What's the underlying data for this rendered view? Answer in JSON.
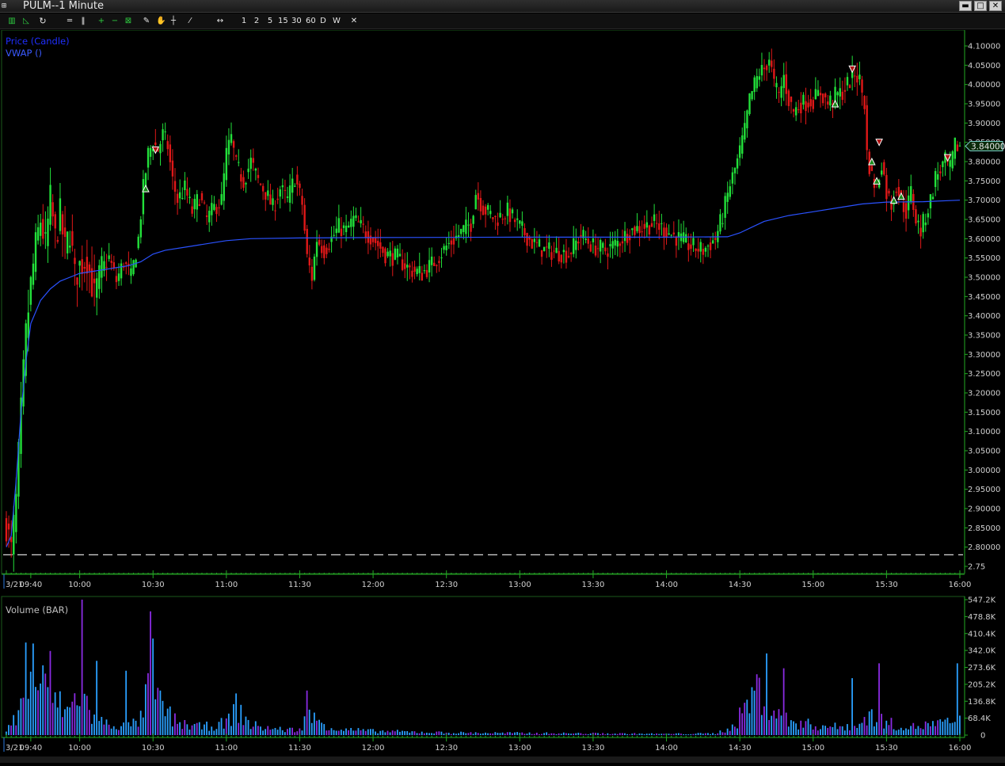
{
  "window": {
    "title": "PULM--1 Minute",
    "app_icon": "chart-app-icon",
    "controls": {
      "minimize": "▬",
      "maximize": "□",
      "close": "✕"
    }
  },
  "toolbar": {
    "periods": [
      "1",
      "2",
      "5",
      "15",
      "30",
      "60",
      "D",
      "W"
    ],
    "close_glyph": "✕"
  },
  "colors": {
    "up": "#22e03a",
    "down": "#e01818",
    "vwap": "#2a52ff",
    "axis": "#22aa22",
    "volume_blue": "#2aa0ff",
    "volume_purple": "#8a2be2",
    "legend_price": "#1f2fff",
    "legend_vwap": "#3a5aff"
  },
  "price_panel": {
    "legend": [
      "Price (Candle)",
      "VWAP ()"
    ],
    "last_price": "3.84000",
    "y_ticks": [
      "4.10000",
      "4.05000",
      "4.00000",
      "3.95000",
      "3.90000",
      "3.85000",
      "3.80000",
      "3.75000",
      "3.70000",
      "3.65000",
      "3.60000",
      "3.55000",
      "3.50000",
      "3.45000",
      "3.40000",
      "3.35000",
      "3.30000",
      "3.25000",
      "3.20000",
      "3.15000",
      "3.10000",
      "3.05000",
      "3.00000",
      "2.95000",
      "2.90000",
      "2.85000",
      "2.80000",
      "2.75"
    ],
    "date_label": "3/21",
    "x_ticks": [
      "09:40",
      "10:00",
      "10:30",
      "11:00",
      "11:30",
      "12:00",
      "12:30",
      "13:00",
      "13:30",
      "14:00",
      "14:30",
      "15:00",
      "15:30",
      "16:00"
    ]
  },
  "volume_panel": {
    "legend": "Volume (BAR)",
    "y_ticks": [
      "547.2K",
      "478.8K",
      "410.4K",
      "342.0K",
      "273.6K",
      "205.2K",
      "136.8K",
      "68.4K",
      "0"
    ],
    "date_label": "3/21",
    "x_ticks": [
      "09:40",
      "10:00",
      "10:30",
      "11:00",
      "11:30",
      "12:00",
      "12:30",
      "13:00",
      "13:30",
      "14:00",
      "14:30",
      "15:00",
      "15:30",
      "16:00"
    ]
  },
  "chart_data": [
    {
      "type": "candlestick",
      "title": "PULM--1 Minute",
      "series": [
        {
          "name": "Price (Candle)"
        },
        {
          "name": "VWAP ()"
        }
      ],
      "ylim": [
        2.75,
        4.12
      ],
      "x_range": [
        "09:30",
        "16:00"
      ],
      "path": [
        [
          "09:30",
          2.86
        ],
        [
          "09:32",
          2.79
        ],
        [
          "09:34",
          2.92
        ],
        [
          "09:36",
          3.15
        ],
        [
          "09:38",
          3.35
        ],
        [
          "09:40",
          3.48
        ],
        [
          "09:42",
          3.58
        ],
        [
          "09:44",
          3.65
        ],
        [
          "09:46",
          3.58
        ],
        [
          "09:48",
          3.7
        ],
        [
          "09:50",
          3.6
        ],
        [
          "09:52",
          3.66
        ],
        [
          "09:54",
          3.57
        ],
        [
          "09:56",
          3.62
        ],
        [
          "09:58",
          3.5
        ],
        [
          "10:00",
          3.53
        ],
        [
          "10:03",
          3.55
        ],
        [
          "10:06",
          3.45
        ],
        [
          "10:09",
          3.52
        ],
        [
          "10:12",
          3.55
        ],
        [
          "10:15",
          3.49
        ],
        [
          "10:18",
          3.54
        ],
        [
          "10:21",
          3.5
        ],
        [
          "10:24",
          3.6
        ],
        [
          "10:26",
          3.73
        ],
        [
          "10:28",
          3.82
        ],
        [
          "10:30",
          3.85
        ],
        [
          "10:32",
          3.83
        ],
        [
          "10:34",
          3.87
        ],
        [
          "10:36",
          3.84
        ],
        [
          "10:38",
          3.75
        ],
        [
          "10:40",
          3.7
        ],
        [
          "10:43",
          3.73
        ],
        [
          "10:46",
          3.67
        ],
        [
          "10:49",
          3.71
        ],
        [
          "10:52",
          3.65
        ],
        [
          "10:55",
          3.68
        ],
        [
          "10:58",
          3.7
        ],
        [
          "11:00",
          3.82
        ],
        [
          "11:02",
          3.86
        ],
        [
          "11:04",
          3.79
        ],
        [
          "11:07",
          3.75
        ],
        [
          "11:10",
          3.8
        ],
        [
          "11:13",
          3.75
        ],
        [
          "11:16",
          3.72
        ],
        [
          "11:19",
          3.68
        ],
        [
          "11:22",
          3.73
        ],
        [
          "11:25",
          3.7
        ],
        [
          "11:28",
          3.76
        ],
        [
          "11:31",
          3.69
        ],
        [
          "11:33",
          3.55
        ],
        [
          "11:35",
          3.5
        ],
        [
          "11:37",
          3.6
        ],
        [
          "11:40",
          3.57
        ],
        [
          "11:43",
          3.6
        ],
        [
          "11:46",
          3.63
        ],
        [
          "11:49",
          3.62
        ],
        [
          "11:52",
          3.65
        ],
        [
          "11:55",
          3.63
        ],
        [
          "12:00",
          3.6
        ],
        [
          "12:05",
          3.56
        ],
        [
          "12:10",
          3.55
        ],
        [
          "12:15",
          3.52
        ],
        [
          "12:20",
          3.51
        ],
        [
          "12:25",
          3.54
        ],
        [
          "12:30",
          3.58
        ],
        [
          "12:35",
          3.61
        ],
        [
          "12:40",
          3.64
        ],
        [
          "12:42",
          3.72
        ],
        [
          "12:45",
          3.68
        ],
        [
          "12:50",
          3.65
        ],
        [
          "12:55",
          3.67
        ],
        [
          "13:00",
          3.63
        ],
        [
          "13:05",
          3.59
        ],
        [
          "13:10",
          3.57
        ],
        [
          "13:20",
          3.56
        ],
        [
          "13:25",
          3.61
        ],
        [
          "13:30",
          3.58
        ],
        [
          "13:35",
          3.57
        ],
        [
          "13:40",
          3.59
        ],
        [
          "13:45",
          3.62
        ],
        [
          "13:50",
          3.63
        ],
        [
          "13:55",
          3.64
        ],
        [
          "14:00",
          3.62
        ],
        [
          "14:05",
          3.6
        ],
        [
          "14:10",
          3.58
        ],
        [
          "14:15",
          3.57
        ],
        [
          "14:20",
          3.6
        ],
        [
          "14:23",
          3.66
        ],
        [
          "14:26",
          3.74
        ],
        [
          "14:29",
          3.8
        ],
        [
          "14:32",
          3.88
        ],
        [
          "14:34",
          3.96
        ],
        [
          "14:36",
          4.0
        ],
        [
          "14:38",
          4.03
        ],
        [
          "14:40",
          4.04
        ],
        [
          "14:42",
          4.07
        ],
        [
          "14:44",
          4.0
        ],
        [
          "14:46",
          3.97
        ],
        [
          "14:48",
          4.02
        ],
        [
          "14:50",
          3.96
        ],
        [
          "14:52",
          3.93
        ],
        [
          "14:55",
          3.95
        ],
        [
          "15:00",
          3.96
        ],
        [
          "15:03",
          3.98
        ],
        [
          "15:06",
          3.95
        ],
        [
          "15:09",
          3.97
        ],
        [
          "15:12",
          3.98
        ],
        [
          "15:15",
          4.01
        ],
        [
          "15:17",
          4.03
        ],
        [
          "15:19",
          4.01
        ],
        [
          "15:21",
          3.95
        ],
        [
          "15:22",
          3.82
        ],
        [
          "15:24",
          3.76
        ],
        [
          "15:26",
          3.73
        ],
        [
          "15:28",
          3.8
        ],
        [
          "15:30",
          3.72
        ],
        [
          "15:32",
          3.69
        ],
        [
          "15:34",
          3.74
        ],
        [
          "15:36",
          3.7
        ],
        [
          "15:38",
          3.67
        ],
        [
          "15:40",
          3.72
        ],
        [
          "15:42",
          3.65
        ],
        [
          "15:44",
          3.62
        ],
        [
          "15:46",
          3.66
        ],
        [
          "15:48",
          3.7
        ],
        [
          "15:50",
          3.76
        ],
        [
          "15:52",
          3.78
        ],
        [
          "15:54",
          3.8
        ],
        [
          "15:56",
          3.78
        ],
        [
          "15:58",
          3.84
        ],
        [
          "16:00",
          3.84
        ]
      ],
      "vwap": [
        [
          "09:30",
          2.8
        ],
        [
          "09:32",
          2.83
        ],
        [
          "09:34",
          2.97
        ],
        [
          "09:36",
          3.15
        ],
        [
          "09:38",
          3.28
        ],
        [
          "09:40",
          3.38
        ],
        [
          "09:44",
          3.44
        ],
        [
          "09:48",
          3.47
        ],
        [
          "09:52",
          3.49
        ],
        [
          "09:56",
          3.5
        ],
        [
          "10:00",
          3.51
        ],
        [
          "10:10",
          3.52
        ],
        [
          "10:20",
          3.53
        ],
        [
          "10:25",
          3.54
        ],
        [
          "10:30",
          3.56
        ],
        [
          "10:35",
          3.57
        ],
        [
          "10:45",
          3.58
        ],
        [
          "10:55",
          3.59
        ],
        [
          "11:00",
          3.595
        ],
        [
          "11:10",
          3.6
        ],
        [
          "11:30",
          3.602
        ],
        [
          "12:00",
          3.603
        ],
        [
          "13:00",
          3.604
        ],
        [
          "14:00",
          3.604
        ],
        [
          "14:25",
          3.605
        ],
        [
          "14:30",
          3.615
        ],
        [
          "14:35",
          3.63
        ],
        [
          "14:40",
          3.645
        ],
        [
          "14:50",
          3.66
        ],
        [
          "15:00",
          3.67
        ],
        [
          "15:10",
          3.68
        ],
        [
          "15:20",
          3.69
        ],
        [
          "15:30",
          3.695
        ],
        [
          "15:45",
          3.696
        ],
        [
          "16:00",
          3.7
        ]
      ],
      "markers": [
        {
          "time": "10:27",
          "price": 3.73,
          "kind": "up"
        },
        {
          "time": "10:31",
          "price": 3.83,
          "kind": "down"
        },
        {
          "time": "15:09",
          "price": 3.95,
          "kind": "up"
        },
        {
          "time": "15:16",
          "price": 4.04,
          "kind": "down"
        },
        {
          "time": "15:24",
          "price": 3.8,
          "kind": "up"
        },
        {
          "time": "15:26",
          "price": 3.75,
          "kind": "up"
        },
        {
          "time": "15:27",
          "price": 3.85,
          "kind": "down"
        },
        {
          "time": "15:33",
          "price": 3.7,
          "kind": "up"
        },
        {
          "time": "15:36",
          "price": 3.71,
          "kind": "up"
        },
        {
          "time": "15:55",
          "price": 3.81,
          "kind": "down"
        }
      ],
      "reference_line": 2.78
    },
    {
      "type": "bar",
      "title": "Volume (BAR)",
      "ylim": [
        0,
        547200
      ],
      "x_range": [
        "09:30",
        "16:00"
      ],
      "profile": [
        [
          "09:30",
          20000
        ],
        [
          "09:35",
          110000
        ],
        [
          "09:38",
          200000
        ],
        [
          "09:40",
          290000
        ],
        [
          "09:44",
          260000
        ],
        [
          "09:48",
          200000
        ],
        [
          "09:52",
          150000
        ],
        [
          "09:56",
          120000
        ],
        [
          "10:00",
          240000
        ],
        [
          "10:05",
          90000
        ],
        [
          "10:10",
          60000
        ],
        [
          "10:15",
          50000
        ],
        [
          "10:20",
          45000
        ],
        [
          "10:25",
          80000
        ],
        [
          "10:28",
          230000
        ],
        [
          "10:32",
          170000
        ],
        [
          "10:36",
          110000
        ],
        [
          "10:40",
          60000
        ],
        [
          "10:50",
          40000
        ],
        [
          "11:00",
          60000
        ],
        [
          "11:04",
          140000
        ],
        [
          "11:10",
          50000
        ],
        [
          "11:20",
          30000
        ],
        [
          "11:30",
          25000
        ],
        [
          "11:33",
          110000
        ],
        [
          "11:36",
          80000
        ],
        [
          "11:45",
          30000
        ],
        [
          "12:00",
          20000
        ],
        [
          "12:30",
          12000
        ],
        [
          "13:00",
          10000
        ],
        [
          "13:30",
          8000
        ],
        [
          "14:00",
          6000
        ],
        [
          "14:20",
          8000
        ],
        [
          "14:27",
          40000
        ],
        [
          "14:30",
          90000
        ],
        [
          "14:34",
          180000
        ],
        [
          "14:38",
          230000
        ],
        [
          "14:42",
          140000
        ],
        [
          "14:46",
          100000
        ],
        [
          "14:50",
          70000
        ],
        [
          "15:00",
          50000
        ],
        [
          "15:10",
          40000
        ],
        [
          "15:20",
          55000
        ],
        [
          "15:22",
          100000
        ],
        [
          "15:26",
          90000
        ],
        [
          "15:30",
          60000
        ],
        [
          "15:40",
          40000
        ],
        [
          "15:50",
          55000
        ],
        [
          "15:56",
          60000
        ],
        [
          "16:00",
          80000
        ]
      ],
      "spikes": [
        {
          "time": "09:38",
          "value": 374000,
          "color": "blue"
        },
        {
          "time": "09:41",
          "value": 370000,
          "color": "blue"
        },
        {
          "time": "09:48",
          "value": 340000,
          "color": "purple"
        },
        {
          "time": "10:01",
          "value": 547200,
          "color": "purple"
        },
        {
          "time": "10:07",
          "value": 300000,
          "color": "blue"
        },
        {
          "time": "10:19",
          "value": 260000,
          "color": "blue"
        },
        {
          "time": "10:29",
          "value": 500000,
          "color": "purple"
        },
        {
          "time": "10:30",
          "value": 390000,
          "color": "blue"
        },
        {
          "time": "11:33",
          "value": 180000,
          "color": "purple"
        },
        {
          "time": "14:41",
          "value": 330000,
          "color": "blue"
        },
        {
          "time": "14:48",
          "value": 270000,
          "color": "purple"
        },
        {
          "time": "15:16",
          "value": 230000,
          "color": "blue"
        },
        {
          "time": "15:27",
          "value": 290000,
          "color": "purple"
        },
        {
          "time": "15:59",
          "value": 290000,
          "color": "blue"
        }
      ]
    }
  ]
}
